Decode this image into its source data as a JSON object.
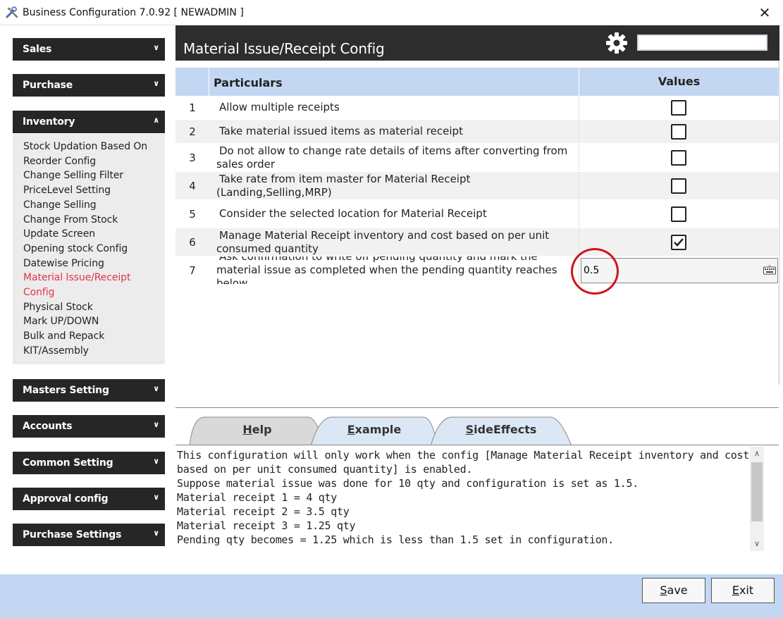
{
  "window": {
    "title": "Business Configuration 7.0.92 [ NEWADMIN ]",
    "close_glyph": "✕"
  },
  "sidebar": {
    "sections": [
      {
        "label": "Sales",
        "expanded": false
      },
      {
        "label": "Purchase",
        "expanded": false
      },
      {
        "label": "Inventory",
        "expanded": true
      },
      {
        "label": "Masters Setting",
        "expanded": false
      },
      {
        "label": "Accounts",
        "expanded": false
      },
      {
        "label": "Common Setting",
        "expanded": false
      },
      {
        "label": "Approval config",
        "expanded": false
      },
      {
        "label": "Purchase Settings",
        "expanded": false
      }
    ],
    "inventory_items": [
      "Stock Updation Based On",
      "Reorder Config",
      "Change Selling Filter",
      "PriceLevel Setting",
      "Change Selling",
      "Change From Stock",
      "Update Screen",
      "Opening stock Config",
      "Datewise Pricing",
      "Material Issue/Receipt",
      "Config",
      "Physical Stock",
      "Mark UP/DOWN",
      "Bulk and Repack",
      "KIT/Assembly"
    ],
    "active_color": "#e0344a"
  },
  "main": {
    "title": "Material Issue/Receipt Config",
    "search_value": ""
  },
  "grid": {
    "col_particulars": "Particulars",
    "col_values": "Values",
    "rows": [
      {
        "num": "1",
        "text": "Allow multiple receipts",
        "type": "checkbox",
        "checked": false
      },
      {
        "num": "2",
        "text": "Take material issued items as material receipt",
        "type": "checkbox",
        "checked": false
      },
      {
        "num": "3",
        "text": "Do not allow to change rate details of items after converting from sales order",
        "type": "checkbox",
        "checked": false
      },
      {
        "num": "4",
        "text": "Take rate from item master for Material Receipt (Landing,Selling,MRP)",
        "type": "checkbox",
        "checked": false
      },
      {
        "num": "5",
        "text": "Consider the selected location for Material Receipt",
        "type": "checkbox",
        "checked": false
      },
      {
        "num": "6",
        "text": "Manage Material Receipt inventory and cost based on per unit consumed quantity",
        "type": "checkbox",
        "checked": true
      },
      {
        "num": "7",
        "text": "Ask confirmation to write off pending quantity and mark the material issue as completed when the pending quantity reaches below",
        "type": "text",
        "value": "0.5"
      }
    ]
  },
  "tabs": [
    {
      "label": "Help",
      "mnemonic": "H",
      "rest": "elp",
      "active": true
    },
    {
      "label": "Example",
      "mnemonic": "E",
      "rest": "xample",
      "active": false
    },
    {
      "label": "SideEffects",
      "mnemonic": "S",
      "rest": "ideEffects",
      "active": false
    }
  ],
  "help_lines": [
    "This configuration will only work when the config [Manage Material Receipt inventory and cost",
    "based on per unit consumed quantity] is enabled.",
    "Suppose material issue was done for 10 qty and configuration is set as 1.5.",
    "Material receipt 1 = 4 qty",
    "Material receipt 2 = 3.5 qty",
    "Material receipt 3 = 1.25 qty",
    "Pending qty becomes = 1.25 which is less than 1.5 set in configuration."
  ],
  "footer": {
    "save": {
      "mnemonic": "S",
      "rest": "ave"
    },
    "exit": {
      "mnemonic": "E",
      "rest": "xit"
    }
  },
  "colors": {
    "header_bg": "#2d2d2d",
    "grid_header_bg": "#c3d7f3",
    "footer_bg": "#c3d7f3",
    "annotation_circle": "#d0121b"
  }
}
